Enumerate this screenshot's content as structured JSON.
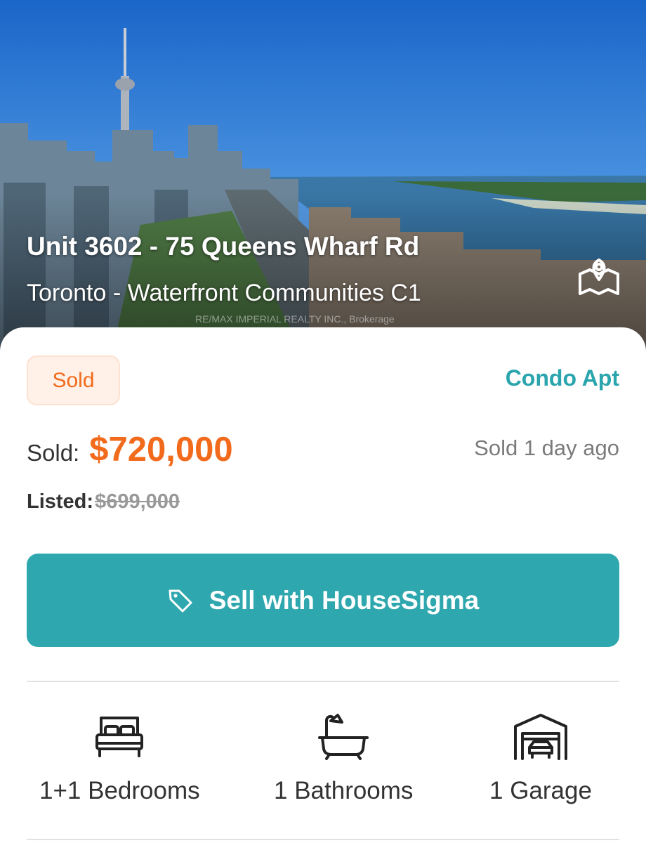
{
  "listing": {
    "title": "Unit 3602 - 75 Queens Wharf Rd",
    "subtitle": "Toronto - Waterfront Communities C1",
    "photo_credit": "RE/MAX IMPERIAL REALTY INC., Brokerage",
    "map_icon": "map-pin-icon"
  },
  "details": {
    "status": "Sold",
    "property_type": "Condo Apt",
    "sold_label": "Sold:",
    "sold_price": "$720,000",
    "sold_ago": "Sold 1 day ago",
    "listed_label": "Listed:",
    "listed_price": "$699,000"
  },
  "cta": {
    "label": "Sell with HouseSigma",
    "icon": "tag-icon"
  },
  "features": [
    {
      "label": "1+1 Bedrooms",
      "icon": "bed-icon"
    },
    {
      "label": "1 Bathrooms",
      "icon": "bathtub-icon"
    },
    {
      "label": "1 Garage",
      "icon": "garage-icon"
    }
  ],
  "colors": {
    "accent": "#2fa7ae",
    "sold": "#f26b1d",
    "badge_bg": "#fff0e8",
    "property_type": "#2aa5ad"
  }
}
